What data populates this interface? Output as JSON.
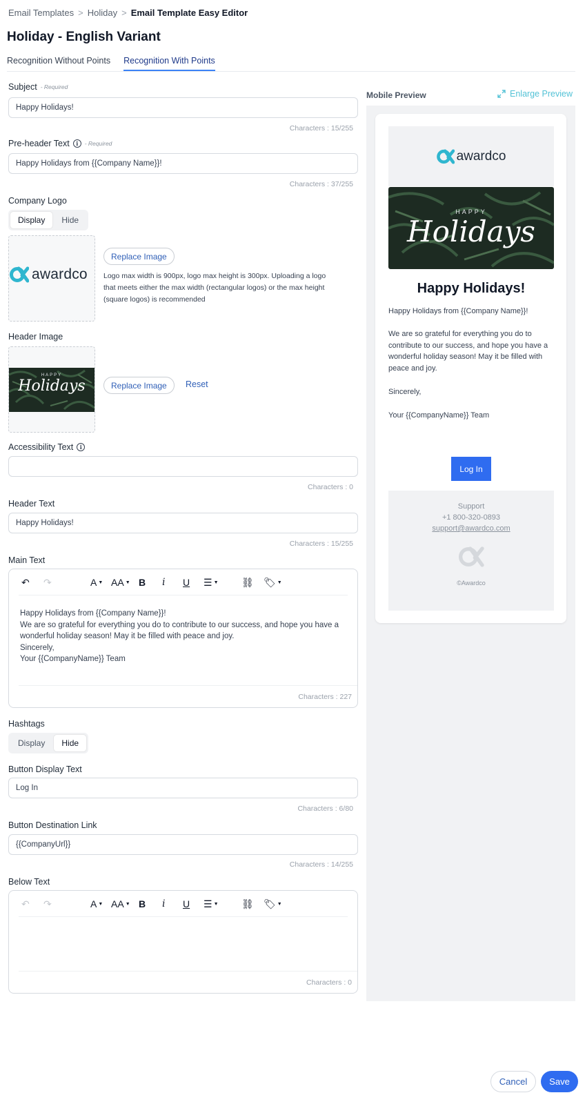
{
  "breadcrumb": {
    "item1": "Email Templates",
    "item2": "Holiday",
    "current": "Email Template Easy Editor",
    "separator": ">"
  },
  "page_title": "Holiday - English Variant",
  "tabs": {
    "tab1": "Recognition Without Points",
    "tab2": "Recognition With Points",
    "active": "Recognition With Points"
  },
  "required_text": "- Required",
  "subject": {
    "label": "Subject",
    "value": "Happy Holidays!",
    "count": "Characters : 15/255"
  },
  "preheader": {
    "label": "Pre-header Text",
    "value": "Happy Holidays from {{Company Name}}!",
    "count": "Characters : 37/255"
  },
  "company_logo": {
    "label": "Company Logo",
    "display": "Display",
    "hide": "Hide",
    "selected": "Display",
    "logo_text": "awardco",
    "replace": "Replace Image",
    "help": "Logo max width is 900px, logo max height is 300px. Uploading a logo that meets either the max width (rectangular logos) or the max height (square logos) is recommended"
  },
  "header_image": {
    "label": "Header Image",
    "replace": "Replace Image",
    "reset": "Reset",
    "banner_small": "HAPPY",
    "banner_big": "Holidays"
  },
  "accessibility": {
    "label": "Accessibility Text",
    "value": "",
    "count": "Characters : 0"
  },
  "header_text": {
    "label": "Header Text",
    "value": "Happy Holidays!",
    "count": "Characters : 15/255"
  },
  "main_text": {
    "label": "Main Text",
    "line1": "Happy Holidays from {{Company Name}}!",
    "line2": "We are so grateful for everything you do to contribute to our success, and hope you have a wonderful holiday season! May it be filled with peace and joy.",
    "line3": "Sincerely,",
    "line4": "Your {{CompanyName}} Team",
    "count": "Characters : 227"
  },
  "toolbar": {
    "font": "A",
    "size": "AA",
    "bold": "B",
    "italic": "i",
    "underline": "U"
  },
  "hashtags": {
    "label": "Hashtags",
    "display": "Display",
    "hide": "Hide",
    "selected": "Hide"
  },
  "button_text": {
    "label": "Button Display Text",
    "value": "Log In",
    "count": "Characters : 6/80"
  },
  "button_link": {
    "label": "Button Destination Link",
    "value": "{{CompanyUrl}}",
    "count": "Characters : 14/255"
  },
  "below_text": {
    "label": "Below Text",
    "count": "Characters : 0"
  },
  "preview": {
    "title": "Mobile Preview",
    "enlarge": "Enlarge Preview",
    "logo_text": "awardco",
    "headline": "Happy Holidays!",
    "greeting": "Happy Holidays from {{Company Name}}!",
    "body": "We are so grateful for everything you do to contribute to our success, and hope you have a wonderful holiday season! May it be filled with peace and joy.",
    "sign": "Sincerely,",
    "team": "Your {{CompanyName}} Team",
    "button": "Log In",
    "support": "Support",
    "phone": "+1 800-320-0893",
    "email": "support@awardco.com",
    "copyright": "©Awardco"
  },
  "actions": {
    "cancel": "Cancel",
    "save": "Save"
  },
  "colors": {
    "accent": "#2f6cf0",
    "link": "#2f5fb7",
    "brand_teal": "#2fb6cf"
  }
}
